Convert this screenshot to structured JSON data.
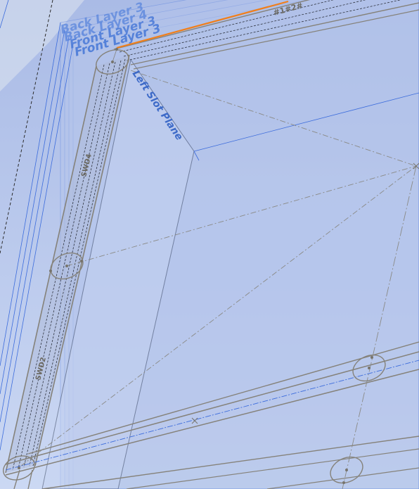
{
  "planes": {
    "back_layer_3": "Back Layer 3",
    "back_layer_4": "Back Layer 4",
    "front_layer_3": "Front Layer 3",
    "front_layer": "Front Layer 3",
    "left_slot_plane": "Left Slot Plane"
  },
  "dimensions": {
    "top_bar": "#1#2#",
    "left_upper": "SWD4",
    "left_lower": "SWD2"
  },
  "colors": {
    "background_top": "#aebfe6",
    "background_bottom": "#c8d6f3",
    "plane_edge": "#3c6cdc",
    "sketch_line": "#85827a",
    "highlight_edge": "#f07f1c",
    "construction": "#8a8a86"
  }
}
